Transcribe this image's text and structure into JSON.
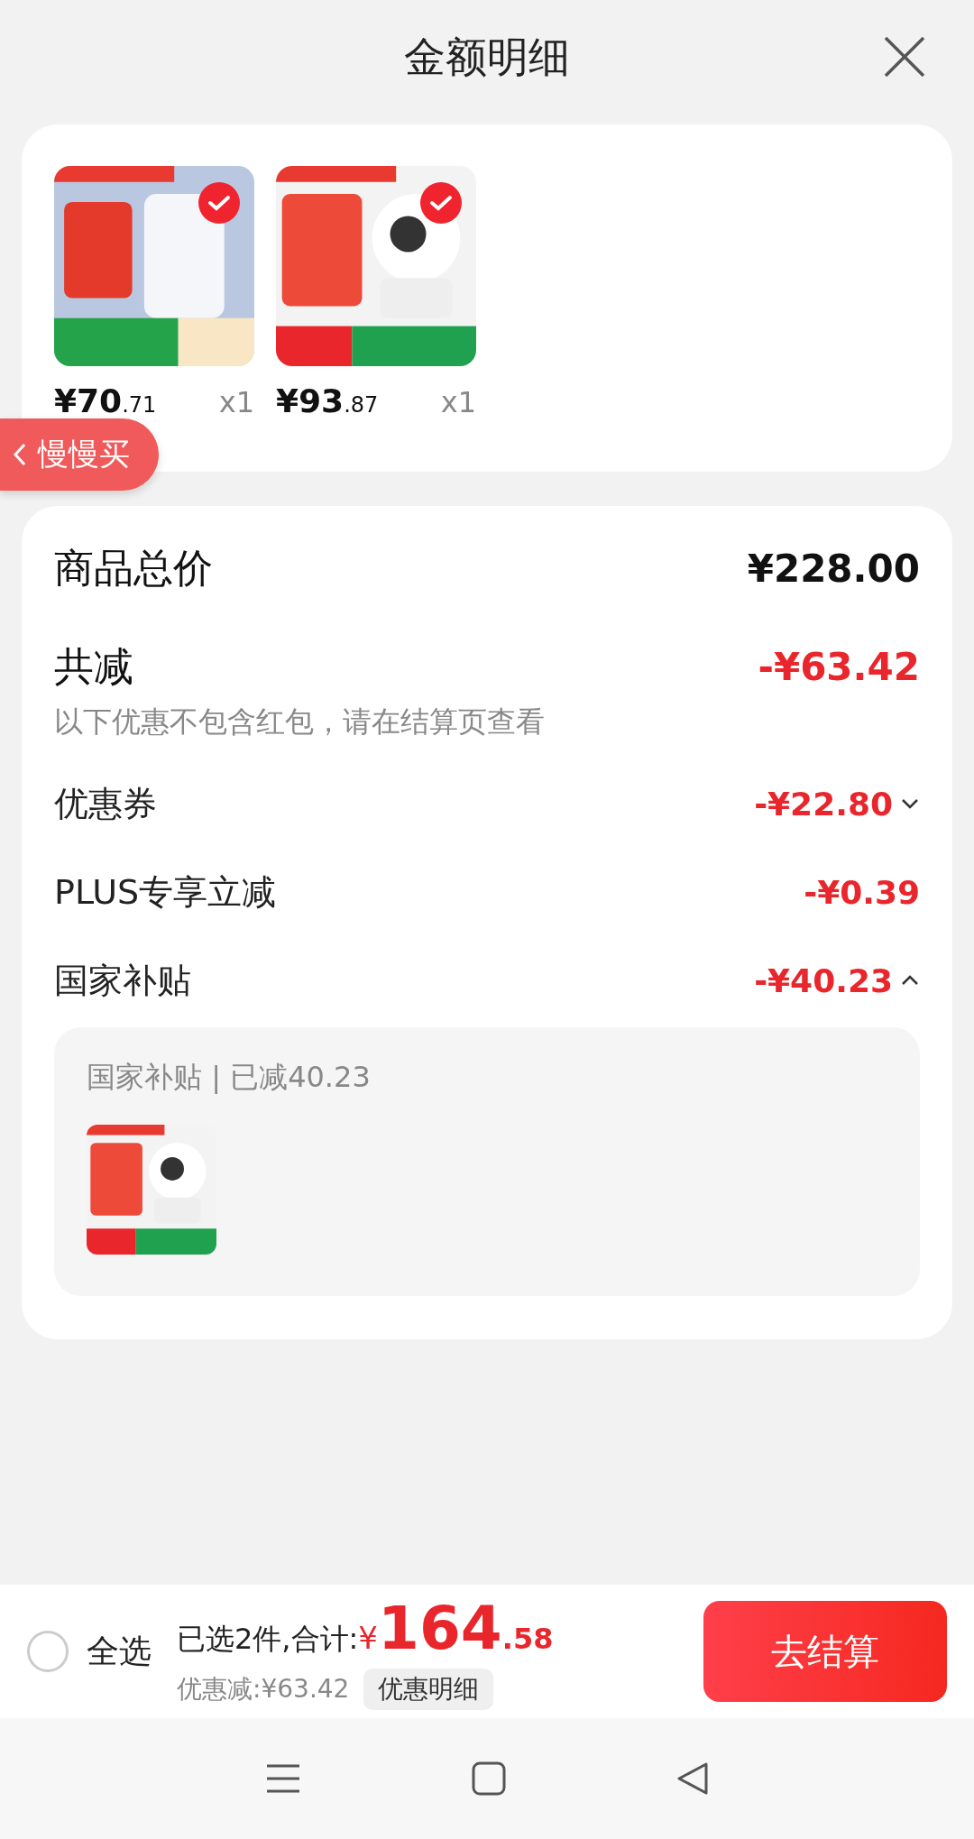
{
  "header": {
    "title": "金额明细"
  },
  "products": [
    {
      "price_main": "¥70",
      "price_decimal": ".71",
      "quantity": "x1",
      "selected": true,
      "kind": "picture"
    },
    {
      "price_main": "¥93",
      "price_decimal": ".87",
      "quantity": "x1",
      "selected": true,
      "kind": "picture"
    }
  ],
  "floating_tag": {
    "label": "慢慢买"
  },
  "summary": {
    "total_label": "商品总价",
    "total_value": "¥228.00",
    "discount_label": "共减",
    "discount_value": "-¥63.42",
    "discount_note": "以下优惠不包含红包，请在结算页查看"
  },
  "discounts": [
    {
      "label": "优惠券",
      "value": "-¥22.80",
      "kind": "expandable",
      "expanded": false
    },
    {
      "label": "PLUS专享立减",
      "value": "-¥0.39",
      "kind": "plain"
    },
    {
      "label": "国家补贴",
      "value": "-¥40.23",
      "kind": "expandable",
      "expanded": true,
      "detail": {
        "title": "国家补贴 | 已减40.23"
      }
    }
  ],
  "footer": {
    "select_all": {
      "label": "全选",
      "checked": false
    },
    "selected_text": "已选2件,合计:",
    "currency": "¥",
    "total_main": "164",
    "total_decimal": ".58",
    "saving": "优惠减:¥63.42",
    "detail_button": "优惠明细",
    "checkout_button": "去结算"
  }
}
